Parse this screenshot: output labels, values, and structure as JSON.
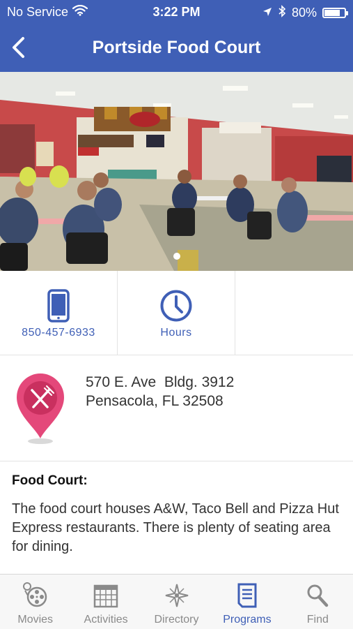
{
  "status_bar": {
    "carrier": "No Service",
    "time": "3:22 PM",
    "battery": "80%",
    "battery_level": 0.8,
    "icons": [
      "wifi-icon",
      "location-icon",
      "bluetooth-icon",
      "battery-icon"
    ]
  },
  "nav": {
    "title": "Portside Food Court",
    "back_icon": "chevron-left-icon"
  },
  "gallery": {
    "page_indicator_count": 1,
    "current_page": 1
  },
  "actions": {
    "phone": {
      "label": "850-457-6933",
      "icon": "phone-icon"
    },
    "hours": {
      "label": "Hours",
      "icon": "clock-icon"
    }
  },
  "address": {
    "line1": "570 E. Ave  Bldg. 3912",
    "line2": "Pensacola, FL 32508",
    "icon": "map-pin-fork-knife-icon"
  },
  "description": {
    "title": "Food Court:",
    "body": "The food court houses A&W, Taco Bell and Pizza Hut Express restaurants. There is plenty of seating area for dining."
  },
  "tabs": [
    {
      "label": "Movies",
      "icon": "film-reel-icon",
      "active": false
    },
    {
      "label": "Activities",
      "icon": "calendar-icon",
      "active": false
    },
    {
      "label": "Directory",
      "icon": "compass-icon",
      "active": false
    },
    {
      "label": "Programs",
      "icon": "document-icon",
      "active": true
    },
    {
      "label": "Find",
      "icon": "search-icon",
      "active": false
    }
  ],
  "colors": {
    "brand": "#3f5fb6",
    "pin": "#e4487a",
    "tab_inactive": "#8a8a8a"
  }
}
